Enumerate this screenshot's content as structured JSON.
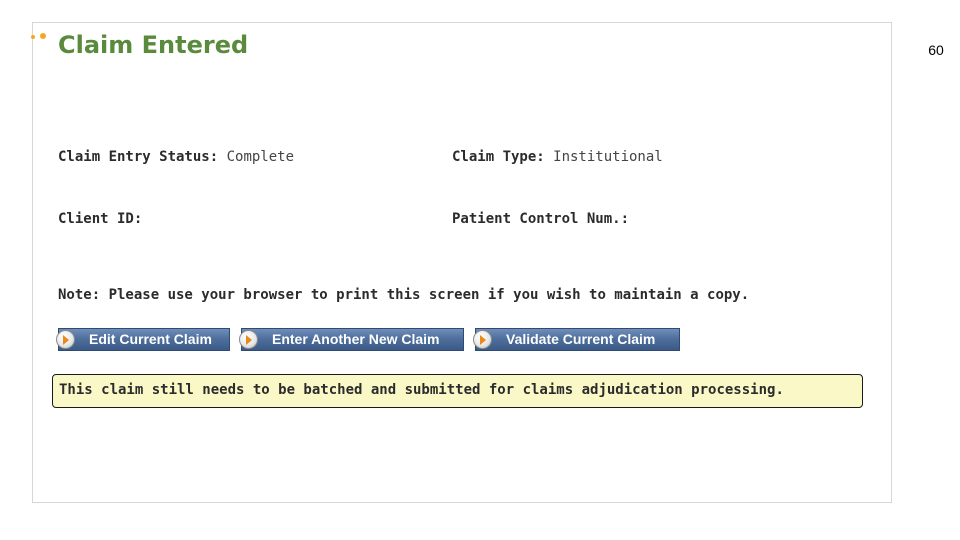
{
  "page": {
    "number": "60"
  },
  "panel": {
    "title": "Claim Entered",
    "fields": {
      "claim_entry_status": {
        "label": "Claim Entry Status:",
        "value": " Complete"
      },
      "claim_type": {
        "label": "Claim Type:",
        "value": " Institutional"
      },
      "client_id": {
        "label": "Client ID:",
        "value": ""
      },
      "patient_control_num": {
        "label": "Patient Control Num.:",
        "value": ""
      }
    },
    "note": "Note: Please use your browser to print this screen if you wish to maintain a copy.",
    "buttons": {
      "edit_current_claim": "Edit Current Claim",
      "enter_another_new_claim": "Enter Another New Claim",
      "validate_current_claim": "Validate Current Claim"
    },
    "notice": "This claim still needs to be batched and submitted for claims adjudication processing."
  },
  "colors": {
    "title": "#5a8a3c",
    "accent_dots": "#f5a623",
    "button_blue": "#4f6f9d",
    "notice_background": "#fbf8c8",
    "button_icon_arrow": "#e8891a"
  },
  "icons": {
    "title_decoration": "orange-dots-icon",
    "button_icon": "orange-arrow-circle-icon"
  }
}
